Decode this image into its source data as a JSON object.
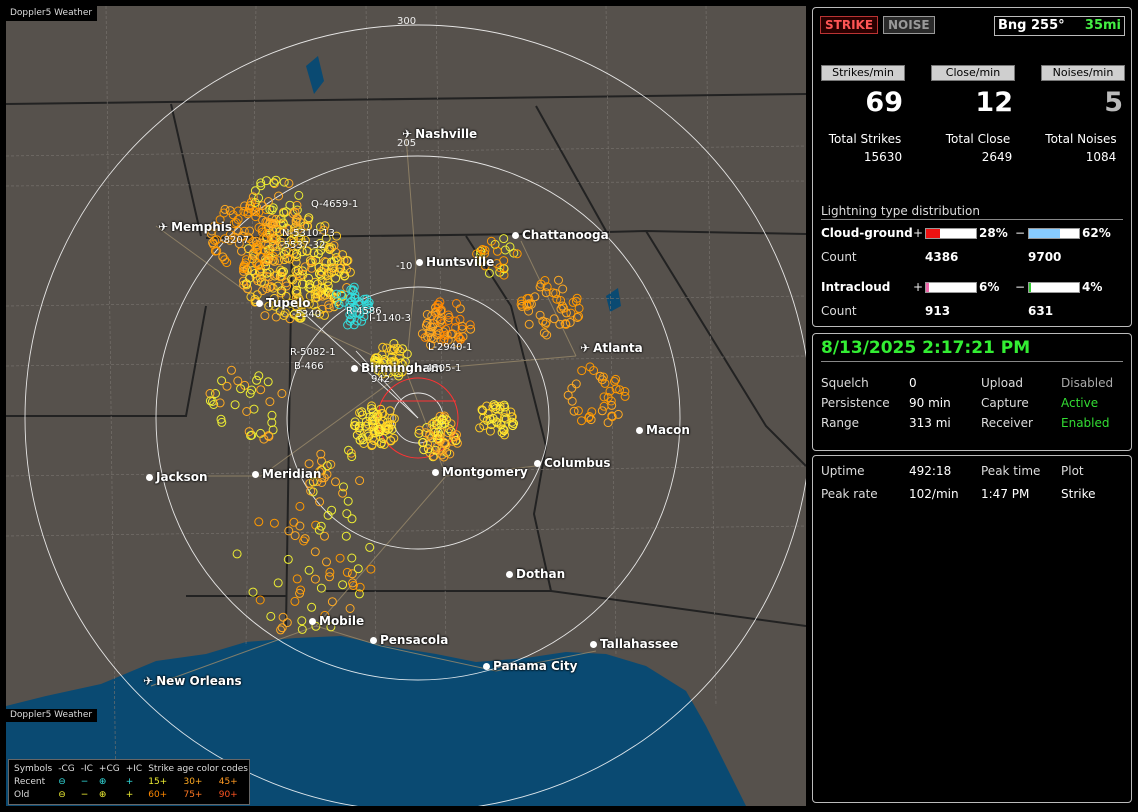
{
  "app": {
    "map_title": "Doppler5 Weather",
    "map_footer": "Doppler5 Weather"
  },
  "map": {
    "ring_labels": [
      "300",
      "205"
    ],
    "cities": [
      {
        "name": "Nashville",
        "icon": "airplane-icon"
      },
      {
        "name": "Memphis",
        "icon": "airplane-icon"
      },
      {
        "name": "Chattanooga",
        "icon": "city-dot-icon"
      },
      {
        "name": "Huntsville",
        "icon": "city-dot-icon"
      },
      {
        "name": "Tupelo",
        "icon": "city-dot-icon"
      },
      {
        "name": "Atlanta",
        "icon": "airplane-icon"
      },
      {
        "name": "Birmingham",
        "icon": "city-dot-icon"
      },
      {
        "name": "Macon",
        "icon": "city-dot-icon"
      },
      {
        "name": "Jackson",
        "icon": "city-dot-icon"
      },
      {
        "name": "Meridian",
        "icon": "city-dot-icon"
      },
      {
        "name": "Montgomery",
        "icon": "city-dot-icon"
      },
      {
        "name": "Columbus",
        "icon": "city-dot-icon"
      },
      {
        "name": "Dothan",
        "icon": "city-dot-icon"
      },
      {
        "name": "Mobile",
        "icon": "city-dot-icon"
      },
      {
        "name": "Pensacola",
        "icon": "city-dot-icon"
      },
      {
        "name": "Tallahassee",
        "icon": "city-dot-icon"
      },
      {
        "name": "Panama City",
        "icon": "city-dot-icon"
      },
      {
        "name": "New Orleans",
        "icon": "airplane-icon"
      }
    ],
    "storm_labels": [
      "Q-4659-1",
      "N-5310-13",
      "-8207",
      "-5537-32",
      "-10",
      "-5340",
      "R-4586",
      "I-1140-3",
      "L-2940-1",
      "R-5082-1",
      "B-466",
      "4305-1",
      "942-"
    ]
  },
  "legend": {
    "headers": [
      "Symbols",
      "-CG",
      "-IC",
      "+CG",
      "+IC",
      "Strike age color codes"
    ],
    "rows": [
      {
        "label": "Recent",
        "ages": [
          "15+",
          "30+",
          "45+"
        ]
      },
      {
        "label": "Old",
        "ages": [
          "60+",
          "75+",
          "90+"
        ]
      }
    ],
    "colors": {
      "cyan": "#33dddd",
      "yellow": "#eeee33",
      "orange": "#ffaa22",
      "dark_orange": "#ff8800"
    }
  },
  "status": {
    "strike_tag": "STRIKE",
    "noise_tag": "NOISE",
    "bearing": "Bng 255°",
    "distance": "35mi"
  },
  "rates": [
    {
      "label": "Strikes/min",
      "value": "69",
      "color": "#ffffff"
    },
    {
      "label": "Close/min",
      "value": "12",
      "color": "#ffffff"
    },
    {
      "label": "Noises/min",
      "value": "5",
      "color": "#bbbbbb"
    }
  ],
  "totals": [
    {
      "label": "Total Strikes",
      "value": "15630"
    },
    {
      "label": "Total Close",
      "value": "2649"
    },
    {
      "label": "Total Noises",
      "value": "1084"
    }
  ],
  "distribution": {
    "title": "Lightning type distribution",
    "cloud_ground": {
      "label": "Cloud-ground",
      "pos_sign": "+",
      "pos_pct": "28%",
      "pos_fraction": 0.28,
      "pos_color": "#ee1111",
      "neg_sign": "−",
      "neg_pct": "62%",
      "neg_fraction": 0.62,
      "neg_color": "#88ccff",
      "count_label": "Count",
      "pos_count": "4386",
      "neg_count": "9700"
    },
    "intracloud": {
      "label": "Intracloud",
      "pos_sign": "+",
      "pos_pct": "6%",
      "pos_fraction": 0.06,
      "pos_color": "#ee66aa",
      "neg_sign": "−",
      "neg_pct": "4%",
      "neg_fraction": 0.04,
      "neg_color": "#33cc33",
      "count_label": "Count",
      "pos_count": "913",
      "neg_count": "631"
    }
  },
  "settings": {
    "datetime": "8/13/2025 2:17:21 PM",
    "squelch_label": "Squelch",
    "squelch": "0",
    "persistence_label": "Persistence",
    "persistence": "90 min",
    "range_label": "Range",
    "range": "313 mi",
    "upload_label": "Upload",
    "upload": "Disabled",
    "capture_label": "Capture",
    "capture": "Active",
    "receiver_label": "Receiver",
    "receiver": "Enabled"
  },
  "info": {
    "uptime_label": "Uptime",
    "uptime": "492:18",
    "peak_time_label": "Peak time",
    "plot_label": "Plot",
    "peak_rate_label": "Peak rate",
    "peak_rate": "102/min",
    "peak_time": "1:47 PM",
    "plot": "Strike"
  }
}
